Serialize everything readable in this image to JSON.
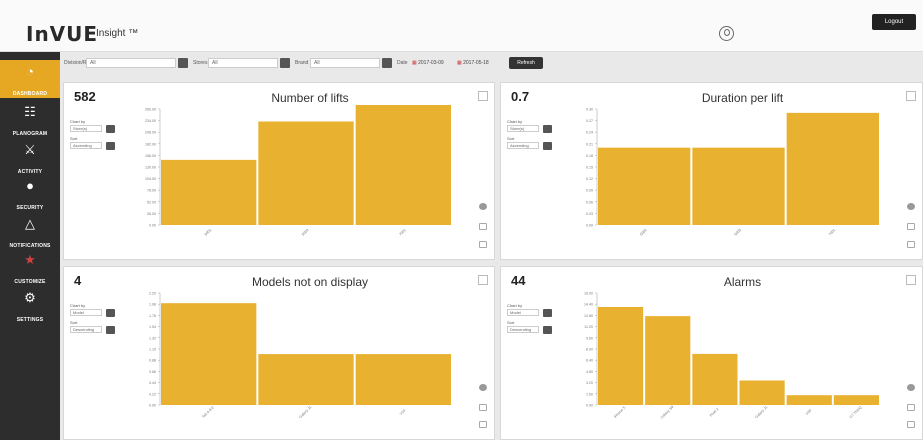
{
  "header": {
    "logo": "InVUE",
    "product": "Insight ™",
    "logout_label": "Logout"
  },
  "sidebar": {
    "items": [
      {
        "label": "DASHBOARD",
        "icon": "dashboard-icon",
        "glyph": "◔",
        "active": true
      },
      {
        "label": "PLANOGRAM",
        "icon": "grid-icon",
        "glyph": "☷",
        "active": false
      },
      {
        "label": "ACTIVITY",
        "icon": "running-person-icon",
        "glyph": "⚔",
        "active": false
      },
      {
        "label": "SECURITY",
        "icon": "globe-icon",
        "glyph": "●",
        "active": false
      },
      {
        "label": "NOTIFICATIONS",
        "icon": "bell-icon",
        "glyph": "△",
        "active": false
      },
      {
        "label": "CUSTOMIZE",
        "icon": "star-icon",
        "glyph": "★",
        "active": false
      },
      {
        "label": "SETTINGS",
        "icon": "gears-icon",
        "glyph": "⚙",
        "active": false
      }
    ]
  },
  "filters": {
    "division_label": "Division/Region",
    "division_value": "All",
    "stores_label": "Stores",
    "stores_value": "All",
    "brand_label": "Brand",
    "brand_value": "All",
    "date_label": "Date",
    "date_from": "2017-03-09",
    "date_to": "2017-05-18",
    "refresh_label": "Refresh"
  },
  "panel_config": {
    "chart_by_label": "Chart by",
    "sort_label": "Sort"
  },
  "panels": [
    {
      "metric": "582",
      "title": "Number of lifts",
      "chart_by": "Store(s)",
      "sort": "Ascending"
    },
    {
      "metric": "0.7",
      "title": "Duration per lift",
      "chart_by": "Store(s)",
      "sort": "Ascending"
    },
    {
      "metric": "4",
      "title": "Models not on display",
      "chart_by": "Model",
      "sort": "Descending"
    },
    {
      "metric": "44",
      "title": "Alarms",
      "chart_by": "Model",
      "sort": "Descending"
    }
  ],
  "colors": {
    "bar": "#e8b130",
    "accent": "#e6a823",
    "sidebar": "#2d2d2d"
  },
  "chart_data": [
    {
      "type": "bar",
      "title": "Number of lifts",
      "categories": [
        "5002",
        "5003",
        "7001"
      ],
      "values": [
        146,
        232,
        298
      ],
      "ylim": [
        0,
        260
      ],
      "yticks": [
        "0.00",
        "26.00",
        "52.00",
        "78.00",
        "104.00",
        "130.00",
        "156.00",
        "182.00",
        "208.00",
        "234.00",
        "260.00"
      ]
    },
    {
      "type": "bar",
      "title": "Duration per lift",
      "categories": [
        "5002",
        "5003",
        "7001"
      ],
      "values": [
        0.2,
        0.2,
        0.29
      ],
      "ylim": [
        0,
        0.3
      ],
      "yticks": [
        "0.00",
        "0.03",
        "0.06",
        "0.09",
        "0.12",
        "0.15",
        "0.18",
        "0.21",
        "0.24",
        "0.27",
        "0.30"
      ]
    },
    {
      "type": "bar",
      "title": "Models not on display",
      "categories": [
        "Tab A 8.0",
        "Galaxy J1",
        "V10"
      ],
      "values": [
        2.0,
        1.0,
        1.0
      ],
      "ylim": [
        0,
        2.2
      ],
      "yticks": [
        "0.00",
        "0.22",
        "0.44",
        "0.66",
        "0.88",
        "1.10",
        "1.32",
        "1.54",
        "1.76",
        "1.98",
        "2.20"
      ]
    },
    {
      "type": "bar",
      "title": "Alarms",
      "categories": [
        "iPhone X",
        "Galaxy S9",
        "Pixel 2",
        "Galaxy J1",
        "V30",
        "G7 ThinQ"
      ],
      "values": [
        14,
        12.7,
        7.3,
        3.5,
        1.4,
        1.4
      ],
      "ylim": [
        0,
        16
      ],
      "yticks": [
        "0.00",
        "1.60",
        "3.20",
        "4.80",
        "6.40",
        "8.00",
        "9.60",
        "11.20",
        "12.80",
        "14.40",
        "16.00"
      ]
    }
  ]
}
